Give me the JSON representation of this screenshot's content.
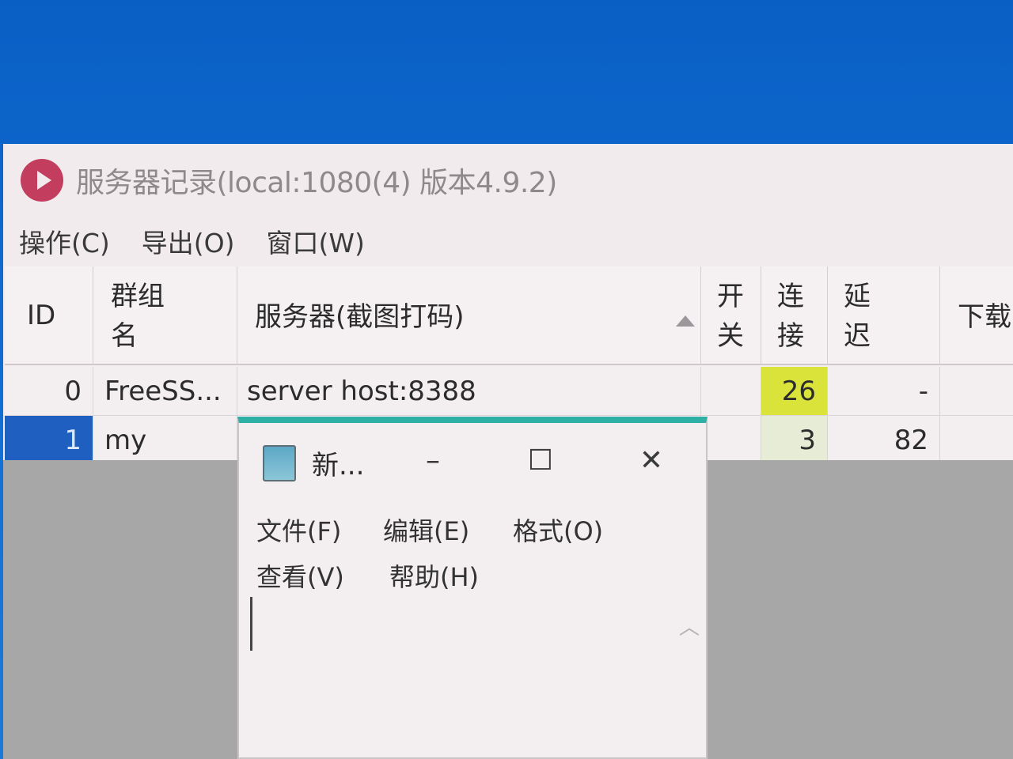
{
  "app": {
    "title": "服务器记录(local:1080(4) 版本4.9.2)",
    "icon": "shadowsocks-icon",
    "menu": [
      "操作(C)",
      "导出(O)",
      "窗口(W)"
    ]
  },
  "table": {
    "headers": {
      "id": "ID",
      "group_line1": "群组",
      "group_line2": "名",
      "server": "服务器(截图打码)",
      "switch_line1": "开",
      "switch_line2": "关",
      "conn_line1": "连",
      "conn_line2": "接",
      "latency_line1": "延",
      "latency_line2": "迟",
      "download": "下载"
    },
    "rows": [
      {
        "id": "0",
        "group": "FreeSS...",
        "server": "server host:8388",
        "switch": "",
        "conn": "26",
        "latency": "-"
      },
      {
        "id": "1",
        "group": "my",
        "server": "",
        "switch": "",
        "conn": "3",
        "latency": "82"
      }
    ],
    "colors": {
      "selected_id_bg": "#1f5fbf",
      "conn_highlight": "#d9e33a",
      "conn_light": "#e6ecd6"
    }
  },
  "notepad": {
    "title": "新...",
    "minimize": "–",
    "maximize": "☐",
    "close": "✕",
    "menu_row1": [
      "文件(F)",
      "编辑(E)",
      "格式(O)"
    ],
    "menu_row2": [
      "查看(V)",
      "帮助(H)"
    ],
    "accent": "#2fb0a6"
  }
}
